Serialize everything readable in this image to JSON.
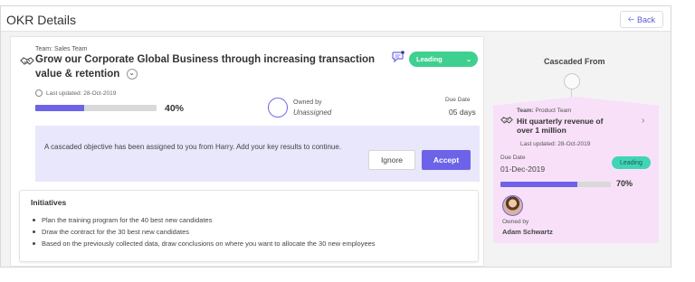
{
  "header": {
    "title": "OKR Details",
    "back_label": "Back"
  },
  "okr": {
    "team": "Team: Sales Team",
    "title": "Grow our Corporate Global Business through increasing transaction value & retention",
    "last_updated": "Last updated: 28-Oct-2019",
    "progress_text": "40%",
    "progress_value": 0.4,
    "owner_label": "Owned by",
    "owner_name": "Unassigned",
    "due_label": "Due Date",
    "due_value": "05 days",
    "status": "Leading",
    "status_color": "#3fd08f"
  },
  "banner": {
    "message": "A cascaded objective has been assigned to you from Harry. Add your key results to continue.",
    "ignore_label": "Ignore",
    "accept_label": "Accept",
    "accent_color": "#6c63e8"
  },
  "initiatives": {
    "heading": "Initiatives",
    "items": [
      "Plan the training program for the 40 best new candidates",
      "Draw the contract for the 30 best new candidates",
      "Based on the previously collected data, draw conclusions on where you want to allocate the 30 new employees"
    ]
  },
  "cascade": {
    "heading": "Cascaded From",
    "team_prefix": "Team:",
    "team_name": " Product Team",
    "title": "Hit quarterly revenue of over 1 million",
    "last_updated": "Last updated: 28-Oct-2019",
    "due_label": "Due Date",
    "due_value": "01-Dec-2019",
    "status": "Leading",
    "progress_text": "70%",
    "progress_value": 0.7,
    "owner_label": "Owned by",
    "owner_name": "Adam Schwartz",
    "card_color": "#f8e0f8"
  },
  "icons": {
    "back": "arrow-left-icon",
    "team": "team-handshake-icon",
    "chat": "chat-bubble-icon",
    "clock": "clock-icon",
    "expand": "chevron-down-icon",
    "navigate": "chevron-right-icon"
  }
}
